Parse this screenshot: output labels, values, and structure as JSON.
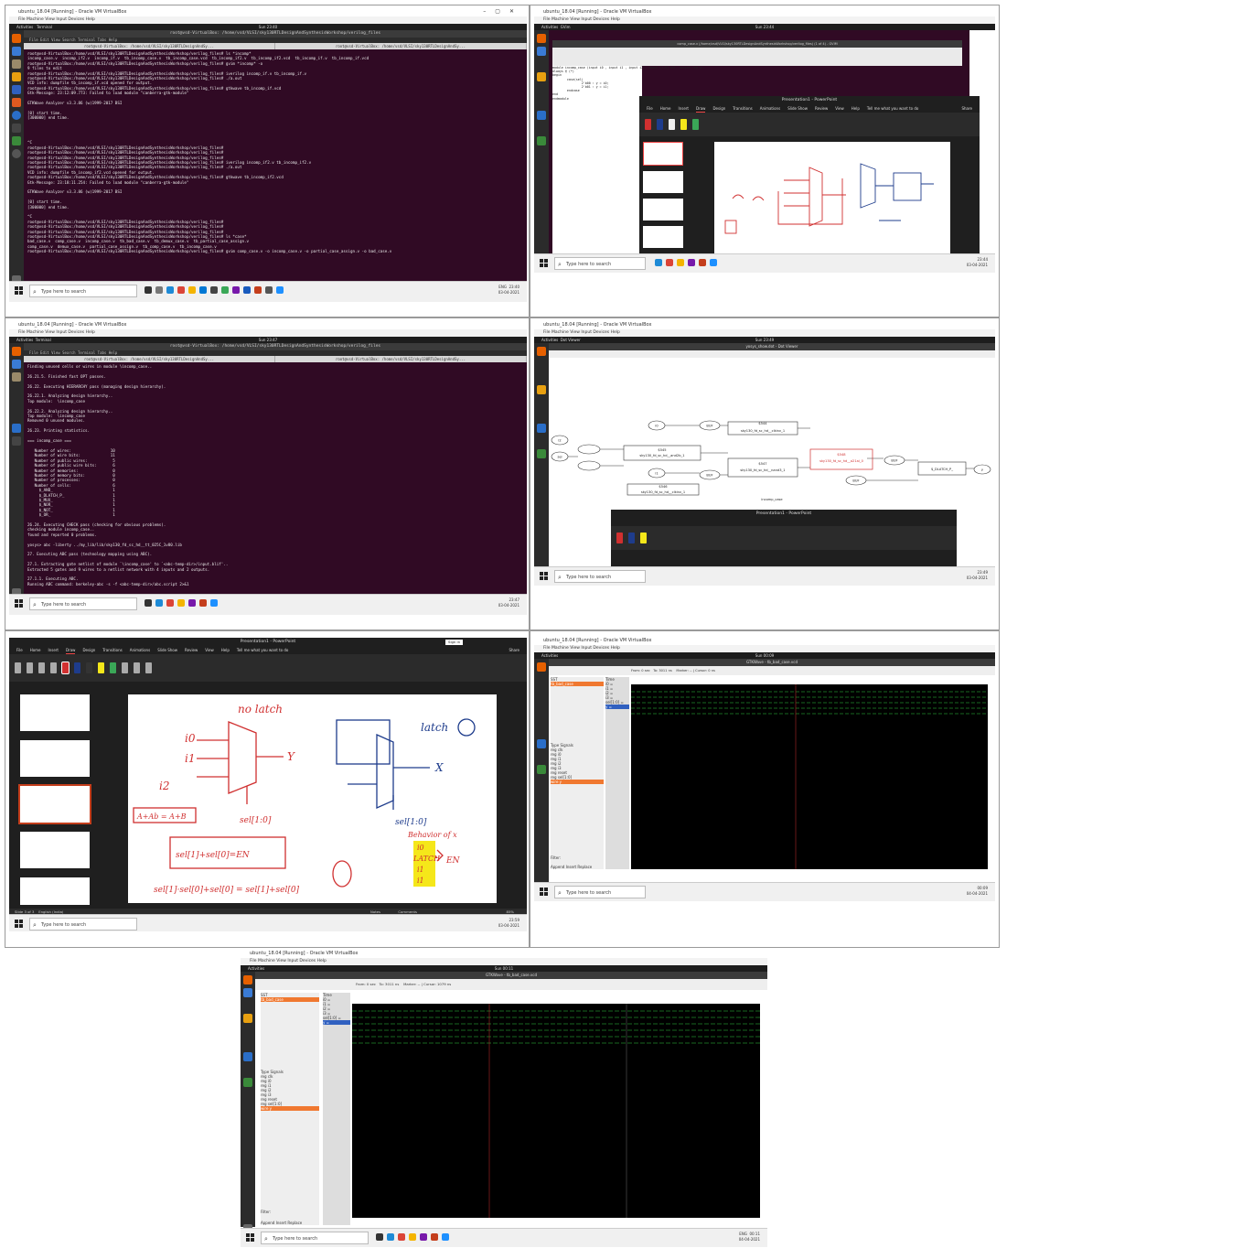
{
  "common": {
    "vbox_title": "ubuntu_18.04 [Running] - Oracle VM VirtualBox",
    "vbox_menu": "File   Machine   View   Input   Devices   Help",
    "activities": "Activities",
    "search_placeholder": "Type here to search",
    "lang": "ENG",
    "ppt_title": "Presentation1 - PowerPoint",
    "ppt_tabs": [
      "File",
      "Home",
      "Insert",
      "Draw",
      "Design",
      "Transitions",
      "Animations",
      "Slide Show",
      "Review",
      "View",
      "Help"
    ],
    "tell_me": "Tell me what you want to do",
    "sign_in": "Sign in",
    "share": "Share"
  },
  "panel1": {
    "gnome_app": "Terminal",
    "clock": "Sun 23:40",
    "term_title": "root@vsd-VirtualBox: /home/vsd/VLSI/sky130RTLDesignAndSynthesisWorkshop/verilog_files",
    "term_menu": "File  Edit  View  Search  Terminal  Tabs  Help",
    "tab1": "root@vsd-VirtualBox: /home/vsd/VLSI/sky130RTLDesignAndSy...",
    "tab2": "root@vsd-VirtualBox: /home/vsd/VLSI/sky130RTLDesignAndSy...",
    "lines": "root@vsd-VirtualBox:/home/vsd/VLSI/sky130RTLDesignAndSynthesisWorkshop/verilog_files# ls *incomp*\nincomp_case.v  incomp_if2.v  incomp_if.v  tb_incomp_case.v  tb_incomp_case.vcd  tb_incomp_if2.v  tb_incomp_if2.vcd  tb_incomp_if.v  tb_incomp_if.vcd\nroot@vsd-VirtualBox:/home/vsd/VLSI/sky130RTLDesignAndSynthesisWorkshop/verilog_files# gvim *incomp* -o\n9 files to edit\nroot@vsd-VirtualBox:/home/vsd/VLSI/sky130RTLDesignAndSynthesisWorkshop/verilog_files# iverilog incomp_if.v tb_incomp_if.v\nroot@vsd-VirtualBox:/home/vsd/VLSI/sky130RTLDesignAndSynthesisWorkshop/verilog_files# ./a.out\nVCD info: dumpfile tb_incomp_if.vcd opened for output.\nroot@vsd-VirtualBox:/home/vsd/VLSI/sky130RTLDesignAndSynthesisWorkshop/verilog_files# gtkwave tb_incomp_if.vcd\nGtk-Message: 23:12:09.773: Failed to load module \"canberra-gtk-module\"\n\nGTKWave Analyzer v3.3.86 (w)1999-2017 BSI\n\n[0] start time.\n[300000] end time.\n\n\n\n\n^C\nroot@vsd-VirtualBox:/home/vsd/VLSI/sky130RTLDesignAndSynthesisWorkshop/verilog_files#\nroot@vsd-VirtualBox:/home/vsd/VLSI/sky130RTLDesignAndSynthesisWorkshop/verilog_files#\nroot@vsd-VirtualBox:/home/vsd/VLSI/sky130RTLDesignAndSynthesisWorkshop/verilog_files#\nroot@vsd-VirtualBox:/home/vsd/VLSI/sky130RTLDesignAndSynthesisWorkshop/verilog_files# iverilog incomp_if2.v tb_incomp_if2.v\nroot@vsd-VirtualBox:/home/vsd/VLSI/sky130RTLDesignAndSynthesisWorkshop/verilog_files# ./a.out\nVCD info: dumpfile tb_incomp_if2.vcd opened for output.\nroot@vsd-VirtualBox:/home/vsd/VLSI/sky130RTLDesignAndSynthesisWorkshop/verilog_files# gtkwave tb_incomp_if2.vcd\nGtk-Message: 23:18:11.254: Failed to load module \"canberra-gtk-module\"\n\nGTKWave Analyzer v3.3.86 (w)1999-2017 BSI\n\n[0] start time.\n[300000] end time.\n\n^C\nroot@vsd-VirtualBox:/home/vsd/VLSI/sky130RTLDesignAndSynthesisWorkshop/verilog_files#\nroot@vsd-VirtualBox:/home/vsd/VLSI/sky130RTLDesignAndSynthesisWorkshop/verilog_files#\nroot@vsd-VirtualBox:/home/vsd/VLSI/sky130RTLDesignAndSynthesisWorkshop/verilog_files#\nroot@vsd-VirtualBox:/home/vsd/VLSI/sky130RTLDesignAndSynthesisWorkshop/verilog_files# ls *case*\nbad_case.v  comp_case.v  incomp_case.v  tb_bad_case.v  tb_demux_case.v  tb_partial_case_assign.v\ncomp_case.v  demux_case.v  partial_case_assign.v  tb_comp_case.v  tb_incomp_case.v\nroot@vsd-VirtualBox:/home/vsd/VLSI/sky130RTLDesignAndSynthesisWorkshop/verilog_files# gvim comp_case.v -o incomp_case.v -o partial_case_assign.v -o bad_case.v",
    "time": "23:40",
    "date": "03-04-2021"
  },
  "panel2": {
    "gnome_app": "GVim",
    "clock": "Sun 23:44",
    "gvim_title": "comp_case.v (/home/vsd/VLSI/sky130RTLDesignAndSynthesisWorkshop/verilog_files) (1 of 4) - GVIM",
    "code": "module incomp_case (input i0 , input i1 , input i2 , input [1:0] sel, output reg y);\nalways @ (*)\nbegin\n        case(sel)\n                2'b00 : y = i0;\n                2'b01 : y = i1;\n        endcase\nend\nendmodule",
    "time": "23:44",
    "date": "03-04-2021"
  },
  "panel3": {
    "clock": "Sun 23:47",
    "lines": "Finding unused cells or wires in module \\incomp_case..\n\n26.21.5. Finished fast OPT passes.\n\n26.22. Executing HIERARCHY pass (managing design hierarchy).\n\n26.22.1. Analyzing design hierarchy..\nTop module:  \\incomp_case\n\n26.22.2. Analyzing design hierarchy..\nTop module:  \\incomp_case\nRemoved 0 unused modules.\n\n26.23. Printing statistics.\n\n=== incomp_case ===\n\n   Number of wires:                 10\n   Number of wire bits:             11\n   Number of public wires:           5\n   Number of public wire bits:       6\n   Number of memories:               0\n   Number of memory bits:            0\n   Number of processes:              0\n   Number of cells:                  6\n     $_AND_                          1\n     $_DLATCH_P_                     1\n     $_MUX_                          1\n     $_NOR_                          1\n     $_NOT_                          1\n     $_OR_                           1\n\n26.24. Executing CHECK pass (checking for obvious problems).\nchecking module incomp_case..\nfound and reported 0 problems.\n\nyosys> abc -liberty ../my_lib/lib/sky130_fd_sc_hd__tt_025C_1v80.lib\n\n27. Executing ABC pass (technology mapping using ABC).\n\n27.1. Extracting gate netlist of module `\\incomp_case' to `<abc-temp-dir>/input.blif'..\nExtracted 5 gates and 9 wires to a netlist network with 4 inputs and 2 outputs.\n\n27.1.1. Executing ABC.\nRunning ABC command: berkeley-abc -s -f <abc-temp-dir>/abc.script 2>&1",
    "time": "23:47",
    "date": "03-04-2021"
  },
  "panel4": {
    "gnome_app": "Dot Viewer",
    "clock": "Sun 23:49",
    "viewer_title": "yosys_show.dot - Dot Viewer",
    "graph_name": "incomp_case",
    "cells": [
      "sky130_fd_sc_hd__clkinv_1",
      "sky130_fd_sc_hd__and2b_1",
      "sky130_fd_sc_hd__nand3_1",
      "sky130_fd_sc_hd__o21ai_0",
      "sky130_fd_sc_hd__clkinv_1"
    ],
    "ids": [
      "$544",
      "$545",
      "$547",
      "$548",
      "$546"
    ],
    "latch": "$_DLATCH_P_",
    "nodes": [
      "i2",
      "i0",
      "sel",
      "i1",
      "y",
      "BUF"
    ],
    "time": "23:49",
    "date": "03-04-2021"
  },
  "panel5": {
    "notes": [
      "no latch",
      "latch",
      "i0",
      "i1",
      "i2",
      "Y",
      "X",
      "sel[1:0]",
      "A+Ab = A+B",
      "sel[1]+sel[0]=EN",
      "sel[1]·sel[0]+sel[0] = sel[1]+sel[0]",
      "Behavior of x",
      "i0",
      "LATCH",
      "i1",
      "i1",
      "EN"
    ],
    "status": "Slide 3 of 3",
    "lang_status": "English (India)",
    "notes_btn": "Notes",
    "comments_btn": "Comments",
    "zoom": "85%",
    "time": "23:59",
    "date": "03-04-2021"
  },
  "panel6": {
    "clock": "Sun 00:09",
    "gtk_title": "GTKWave - tb_bad_case.vcd",
    "from": "0 sec",
    "to": "3011 ns",
    "marker": "Marker: -- | Cursor: 0 ns",
    "sst": "SST",
    "tree": "tb_bad_case",
    "signals_hdr": [
      "Type",
      "Signals"
    ],
    "signals": [
      "reg  clk",
      "reg  i0",
      "reg  i1",
      "reg  i2",
      "reg  i3",
      "reg  reset",
      "reg  sel[1:0]",
      "wire  y"
    ],
    "wave_names": [
      "Time",
      "i0 =",
      "i1 =",
      "i2 =",
      "i3 =",
      "sel[1:0] =",
      "y ="
    ],
    "filter": "Filter:",
    "btns": [
      "Append",
      "Insert",
      "Replace"
    ],
    "time": "00:09",
    "date": "04-04-2021"
  },
  "panel7": {
    "clock": "Sun 00:11",
    "gtk_title": "GTKWave - tb_bad_case.vcd",
    "from": "0 sec",
    "to": "3011 ns",
    "marker": "Marker: -- | Cursor: 1079 ns",
    "sst": "SST",
    "tree": "tb_bad_case",
    "signals": [
      "reg  clk",
      "reg  i0",
      "reg  i1",
      "reg  i2",
      "reg  i3",
      "reg  reset",
      "reg  sel[1:0]",
      "wire  y"
    ],
    "wave_names": [
      "Time",
      "i0 =",
      "i1 =",
      "i2 =",
      "i3 =",
      "sel[1:0] =",
      "y ="
    ],
    "filter": "Filter:",
    "btns": [
      "Append",
      "Insert",
      "Replace"
    ],
    "time": "00:11",
    "date": "04-04-2021"
  },
  "colors": {
    "terminal_bg": "#300a24",
    "ppt_bg": "#1f1f1f",
    "ink_red": "#d03030",
    "ink_blue": "#1e3c8c",
    "ink_highlight": "#f5e71a",
    "wave_green": "#2ecc40",
    "gtk_select": "#f07830"
  }
}
